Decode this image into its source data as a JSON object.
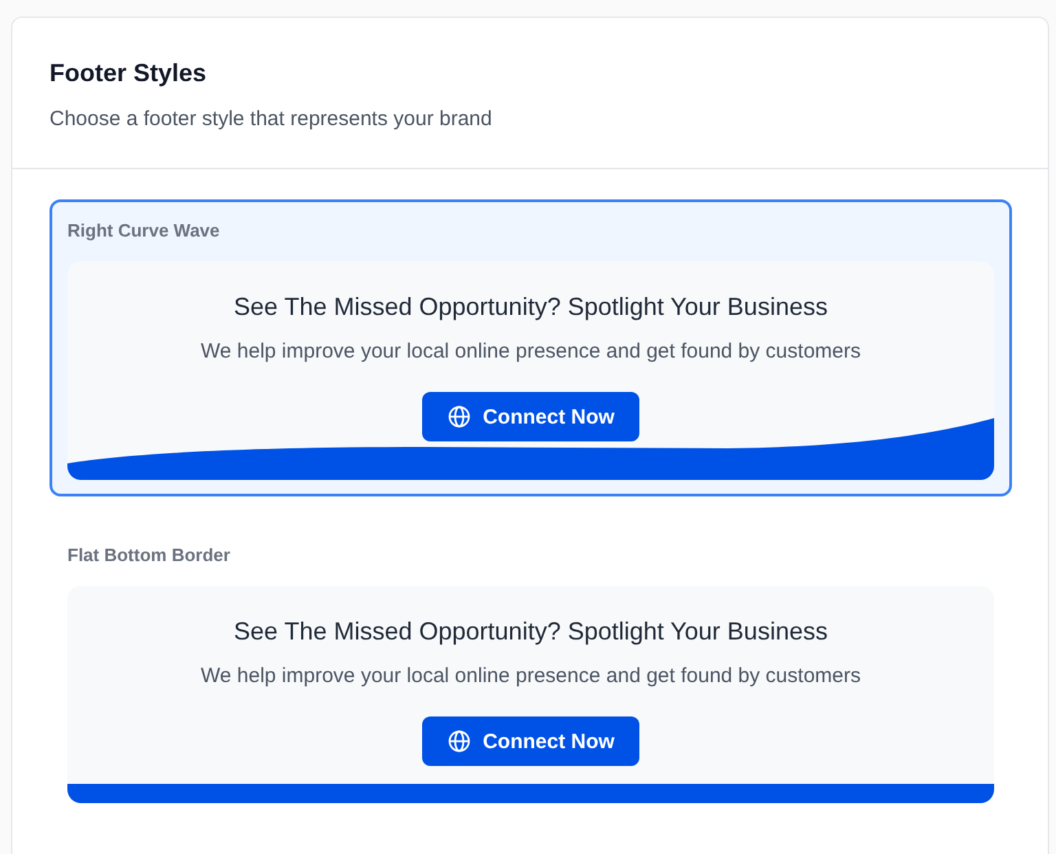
{
  "header": {
    "title": "Footer Styles",
    "subtitle": "Choose a footer style that represents your brand"
  },
  "options": [
    {
      "label": "Right Curve Wave",
      "kind": "curve",
      "selected": true,
      "preview": {
        "heading": "See The Missed Opportunity? Spotlight Your Business",
        "text": "We help improve your local online presence and get found by customers",
        "button": "Connect Now"
      }
    },
    {
      "label": "Flat Bottom Border",
      "kind": "flat",
      "selected": false,
      "preview": {
        "heading": "See The Missed Opportunity? Spotlight Your Business",
        "text": "We help improve your local online presence and get found by customers",
        "button": "Connect Now"
      }
    }
  ]
}
